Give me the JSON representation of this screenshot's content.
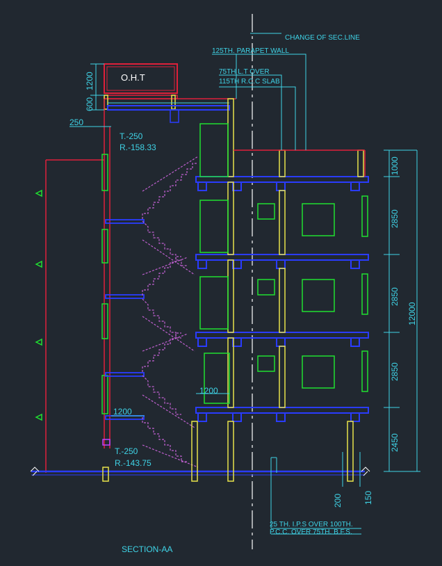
{
  "drawing": {
    "title": "SECTION-AA",
    "colors": {
      "background": "#212830",
      "slab": "#2a3cff",
      "wall": "#e0203a",
      "column": "#e8e24a",
      "window": "#20e030",
      "stair": "#c060d0",
      "dimension": "#3fd3e6",
      "centerline": "#ffffff"
    },
    "oht_label": "O.H.T",
    "annotations": {
      "change_of_sec_line": "CHANGE OF SEC.LINE",
      "parapet": "125TH. PARAPET WALL",
      "lintel": "75TH L.T OVER",
      "rcc_slab": "115TH R.C.C SLAB",
      "top_level_t": "T.-250",
      "top_level_r": "R.-158.33",
      "bottom_level_t": "T.-250",
      "bottom_level_r": "R.-143.75",
      "ips_line1": "25 TH. I.P.S OVER 100TH.",
      "ips_line2": "P.C.C. OVER 75TH. B.F.S."
    },
    "dimensions": {
      "oht_height": "1200",
      "oht_base": "600",
      "overhang": "250",
      "parapet": "1000",
      "floor_1": "2850",
      "floor_2": "2850",
      "floor_3": "2850",
      "plinth": "2450",
      "total": "12000",
      "landing_width_1": "1200",
      "landing_width_2": "1200",
      "ground_offset_1": "200",
      "ground_offset_2": "150"
    }
  }
}
